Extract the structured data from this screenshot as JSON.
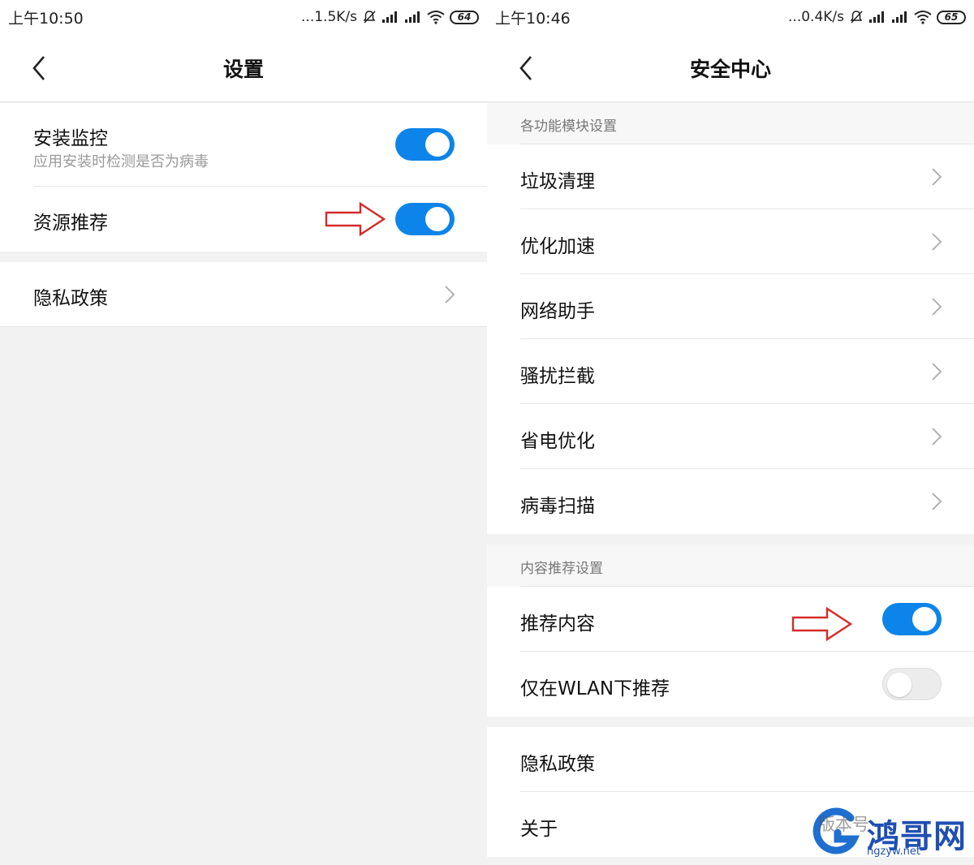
{
  "colors": {
    "accent": "#0d84ea",
    "arrow": "#d42a2a",
    "watermark": "#1f4fb4"
  },
  "left": {
    "status": {
      "time": "上午10:50",
      "speed": "...1.5K/s",
      "battery": "64"
    },
    "header": {
      "title": "设置",
      "back_icon": "chevron-left-icon"
    },
    "items": [
      {
        "label": "安装监控",
        "sub": "应用安装时检测是否为病毒",
        "toggle": "on"
      },
      {
        "label": "资源推荐",
        "toggle": "on"
      },
      {
        "label": "隐私政策",
        "icon": "chevron-right-icon"
      }
    ]
  },
  "right": {
    "status": {
      "time": "上午10:46",
      "speed": "...0.4K/s",
      "battery": "65"
    },
    "header": {
      "title": "安全中心",
      "back_icon": "chevron-left-icon"
    },
    "section1": {
      "header": "各功能模块设置",
      "items": [
        "垃圾清理",
        "优化加速",
        "网络助手",
        "骚扰拦截",
        "省电优化",
        "病毒扫描"
      ]
    },
    "section2": {
      "header": "内容推荐设置",
      "items": [
        {
          "label": "推荐内容",
          "toggle": "on"
        },
        {
          "label": "仅在WLAN下推荐",
          "toggle": "off"
        }
      ]
    },
    "section3": {
      "items": [
        "隐私政策",
        "关于"
      ]
    }
  },
  "watermark": {
    "brand": "鸿哥网",
    "url": "hgzyw.net",
    "overlay": "版本号"
  }
}
